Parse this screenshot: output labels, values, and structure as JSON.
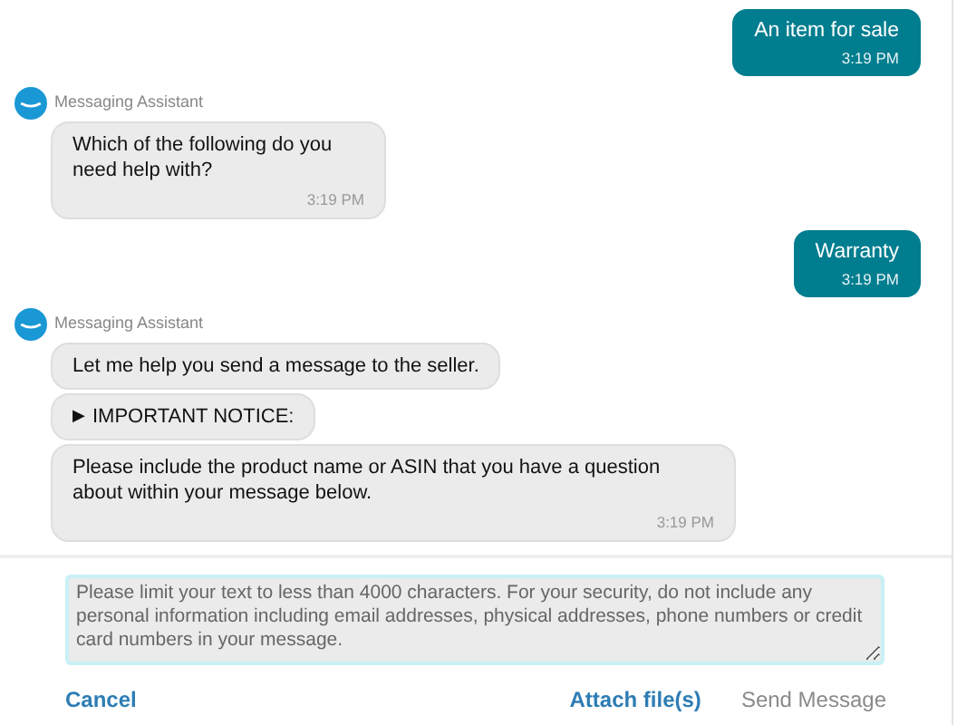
{
  "messages": [
    {
      "kind": "user",
      "text": "An item for sale",
      "time": "3:19 PM"
    },
    {
      "kind": "assistant",
      "sender": "Messaging Assistant",
      "bubbles": [
        {
          "kind": "question",
          "text": "Which of the following do you need help with?",
          "time": "3:19 PM"
        }
      ]
    },
    {
      "kind": "user",
      "text": "Warranty",
      "time": "3:19 PM"
    },
    {
      "kind": "assistant",
      "sender": "Messaging Assistant",
      "bubbles": [
        {
          "kind": "text",
          "text": "Let me help you send a message to the seller."
        },
        {
          "kind": "disclosure",
          "marker": "▶",
          "text": "IMPORTANT NOTICE:",
          "expanded": false
        },
        {
          "kind": "text",
          "text": "Please include the product name or ASIN that you have a question about within your message below.",
          "time": "3:19 PM"
        }
      ]
    }
  ],
  "composer": {
    "placeholder": "Please limit your text to less than 4000 characters. For your security, do not include any personal information including email addresses, physical addresses, phone numbers or credit card numbers in your message.",
    "cancel": "Cancel",
    "attach": "Attach file(s)",
    "send": {
      "label": "Send Message",
      "disabled": true
    }
  }
}
